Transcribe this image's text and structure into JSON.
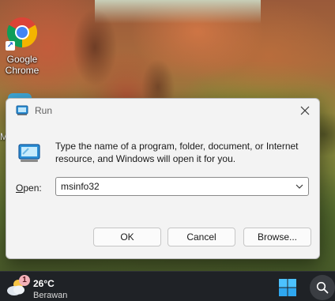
{
  "desktop": {
    "icons": [
      {
        "label_line1": "Google",
        "label_line2": "Chrome",
        "icon": "chrome-icon"
      }
    ],
    "partial_icon_letter": "M"
  },
  "run_dialog": {
    "title": "Run",
    "description": "Type the name of a program, folder, document, or Internet resource, and Windows will open it for you.",
    "open_label_underlined": "O",
    "open_label_rest": "pen:",
    "open_value": "msinfo32",
    "buttons": {
      "ok": "OK",
      "cancel": "Cancel",
      "browse": "Browse..."
    },
    "icons": {
      "title": "run-icon",
      "close": "close-icon",
      "dropdown": "chevron-down-icon"
    }
  },
  "taskbar": {
    "weather": {
      "temperature": "26°C",
      "condition": "Berawan",
      "badge": "1",
      "icon": "partly-cloudy-icon"
    },
    "start_icon": "windows-start-icon",
    "search_icon": "search-icon"
  }
}
